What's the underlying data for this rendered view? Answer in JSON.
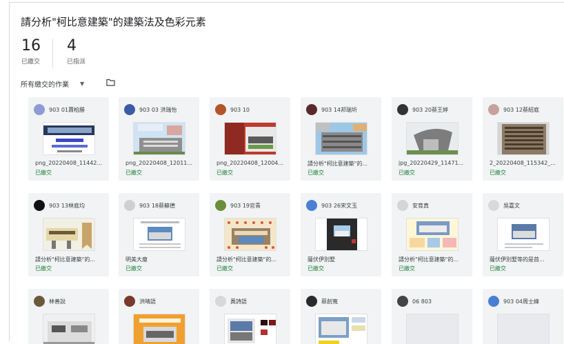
{
  "assignment": {
    "title": "請分析\"柯比意建築\"的建築法及色彩元素"
  },
  "stats": [
    {
      "value": "16",
      "label": "已繳交"
    },
    {
      "value": "4",
      "label": "已指派"
    }
  ],
  "filter": {
    "label": "所有繳交的作業"
  },
  "colors": {
    "submitted": "#188038",
    "card_bg": "#f1f3f4"
  },
  "rows": [
    [
      {
        "name": "903 01蕭柏勝",
        "file": "png_20220408_11442...",
        "status": "已繳交",
        "avatar": "#8e9bd6",
        "thumb": "thumb-poster"
      },
      {
        "name": "903 03 洪瑞怡",
        "file": "png_20220408_12011...",
        "status": "已繳交",
        "avatar": "#3b5aa8",
        "thumb": "thumb-sky"
      },
      {
        "name": "903 10",
        "file": "png_20220408_12004...",
        "status": "已繳交",
        "avatar": "#b3542b",
        "thumb": "thumb-red"
      },
      {
        "name": "903 14邦瑞圻",
        "file": "請分析\"柯比意建築\"的...",
        "status": "已繳交",
        "avatar": "#5a2a2a",
        "thumb": "thumb-concrete"
      },
      {
        "name": "903 20蔡王婷",
        "file": "jpg_20220429_11471...",
        "status": "已繳交",
        "avatar": "#333333",
        "thumb": "thumb-chapel"
      },
      {
        "name": "903 12蔡紹庭",
        "file": "2_20220408_115342_...",
        "status": "已繳交",
        "avatar": "#c9a0a0",
        "thumb": "thumb-block"
      }
    ],
    [
      {
        "name": "903 13林庭均",
        "file": "請分析\"柯比意建築\"的...",
        "status": "已繳交",
        "avatar": "#111111",
        "thumb": "thumb-villa"
      },
      {
        "name": "903 18蔡蘇德",
        "file": "明美大廈",
        "status": "已繳交",
        "avatar": "#d0d0d0",
        "thumb": "thumb-doc"
      },
      {
        "name": "903 19官青",
        "file": "請分析\"柯比意建築\"的...",
        "status": "已繳交",
        "avatar": "#6b8e3a",
        "thumb": "thumb-dots"
      },
      {
        "name": "903 26宋文玉",
        "file": "薩伏伊別墅",
        "status": "已繳交",
        "avatar": "#4a7fd4",
        "thumb": "thumb-dark"
      },
      {
        "name": "安育真",
        "file": "請分析\"柯比意建築\"的...",
        "status": "已繳交",
        "avatar": "#d5d5d5",
        "thumb": "thumb-collage"
      },
      {
        "name": "吳嘉文",
        "file": "薩伏伊別墅等的是首...",
        "status": "已繳交",
        "avatar": "#d9d9d9",
        "thumb": "thumb-slide"
      }
    ],
    [
      {
        "name": "林善說",
        "file": "",
        "status": "",
        "avatar": "#6b5a3a",
        "thumb": "thumb-house"
      },
      {
        "name": "洪晴語",
        "file": "",
        "status": "",
        "avatar": "#7a3a2a",
        "thumb": "thumb-orange"
      },
      {
        "name": "黃詩語",
        "file": "",
        "status": "",
        "avatar": "#d8d8d8",
        "thumb": "thumb-swatch"
      },
      {
        "name": "蔡創寬",
        "file": "",
        "status": "",
        "avatar": "#2a2a2a",
        "thumb": "thumb-palette"
      },
      {
        "name": "06 803",
        "file": "",
        "status": "",
        "avatar": "#444444",
        "thumb": "thumb-empty"
      },
      {
        "name": "903 04周士緯",
        "file": "",
        "status": "",
        "avatar": "#4a7fd4",
        "thumb": "thumb-empty"
      }
    ]
  ]
}
